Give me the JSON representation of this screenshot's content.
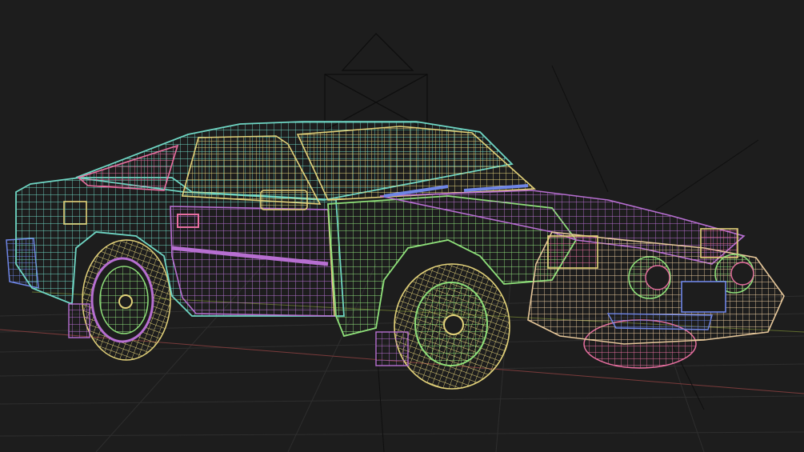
{
  "viewport": {
    "background": "#1d1d1d",
    "grid_color": "#2e2e2e",
    "axis_x_color": "#7a3b3b",
    "axis_y_color": "#5f6b2e"
  },
  "wireframe_colors": {
    "cyan": "#6fd6c4",
    "yellow": "#e3d27a",
    "green": "#8fe07a",
    "purple": "#b76fd1",
    "blue": "#6f86e6",
    "pink": "#e86fa0",
    "peach": "#e6c79a"
  },
  "scene": {
    "object": "wireframe-car",
    "shading": "wireframe"
  }
}
